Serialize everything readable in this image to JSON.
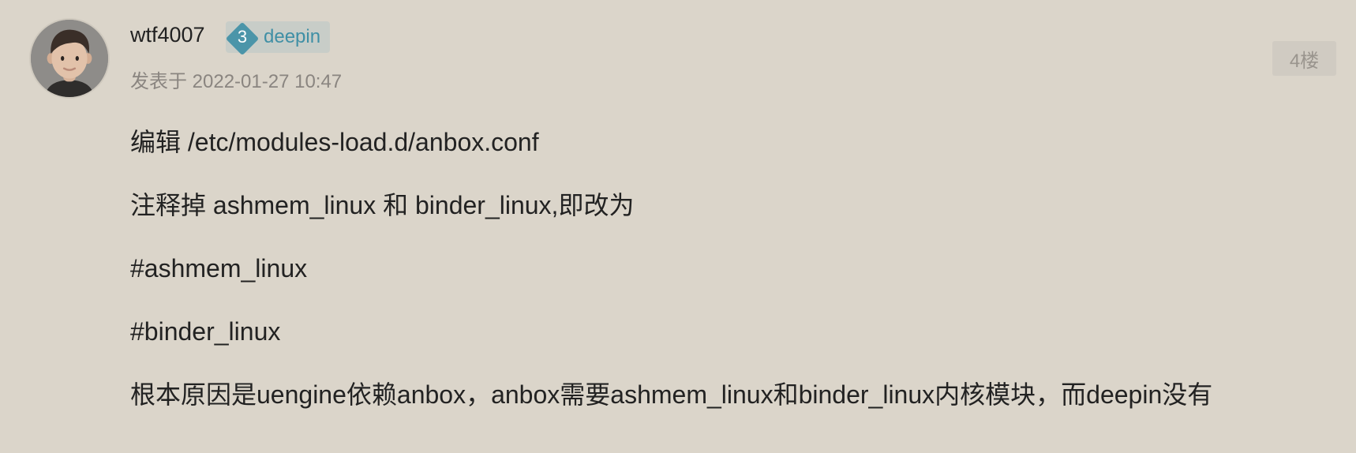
{
  "post": {
    "author": {
      "username": "wtf4007",
      "level_number": "3",
      "level_name": "deepin"
    },
    "posted_at": "发表于 2022-01-27 10:47",
    "floor": "4楼",
    "paragraphs": [
      "编辑 /etc/modules-load.d/anbox.conf",
      "注释掉 ashmem_linux 和 binder_linux,即改为",
      "#ashmem_linux",
      "#binder_linux",
      "根本原因是uengine依赖anbox，anbox需要ashmem_linux和binder_linux内核模块，而deepin没有"
    ]
  },
  "colors": {
    "background": "#dbd5ca",
    "level_accent": "#4b95a9",
    "level_badge_bg": "#c8cdc8"
  },
  "icons": {
    "avatar": "user-avatar",
    "level": "level-diamond-icon"
  }
}
